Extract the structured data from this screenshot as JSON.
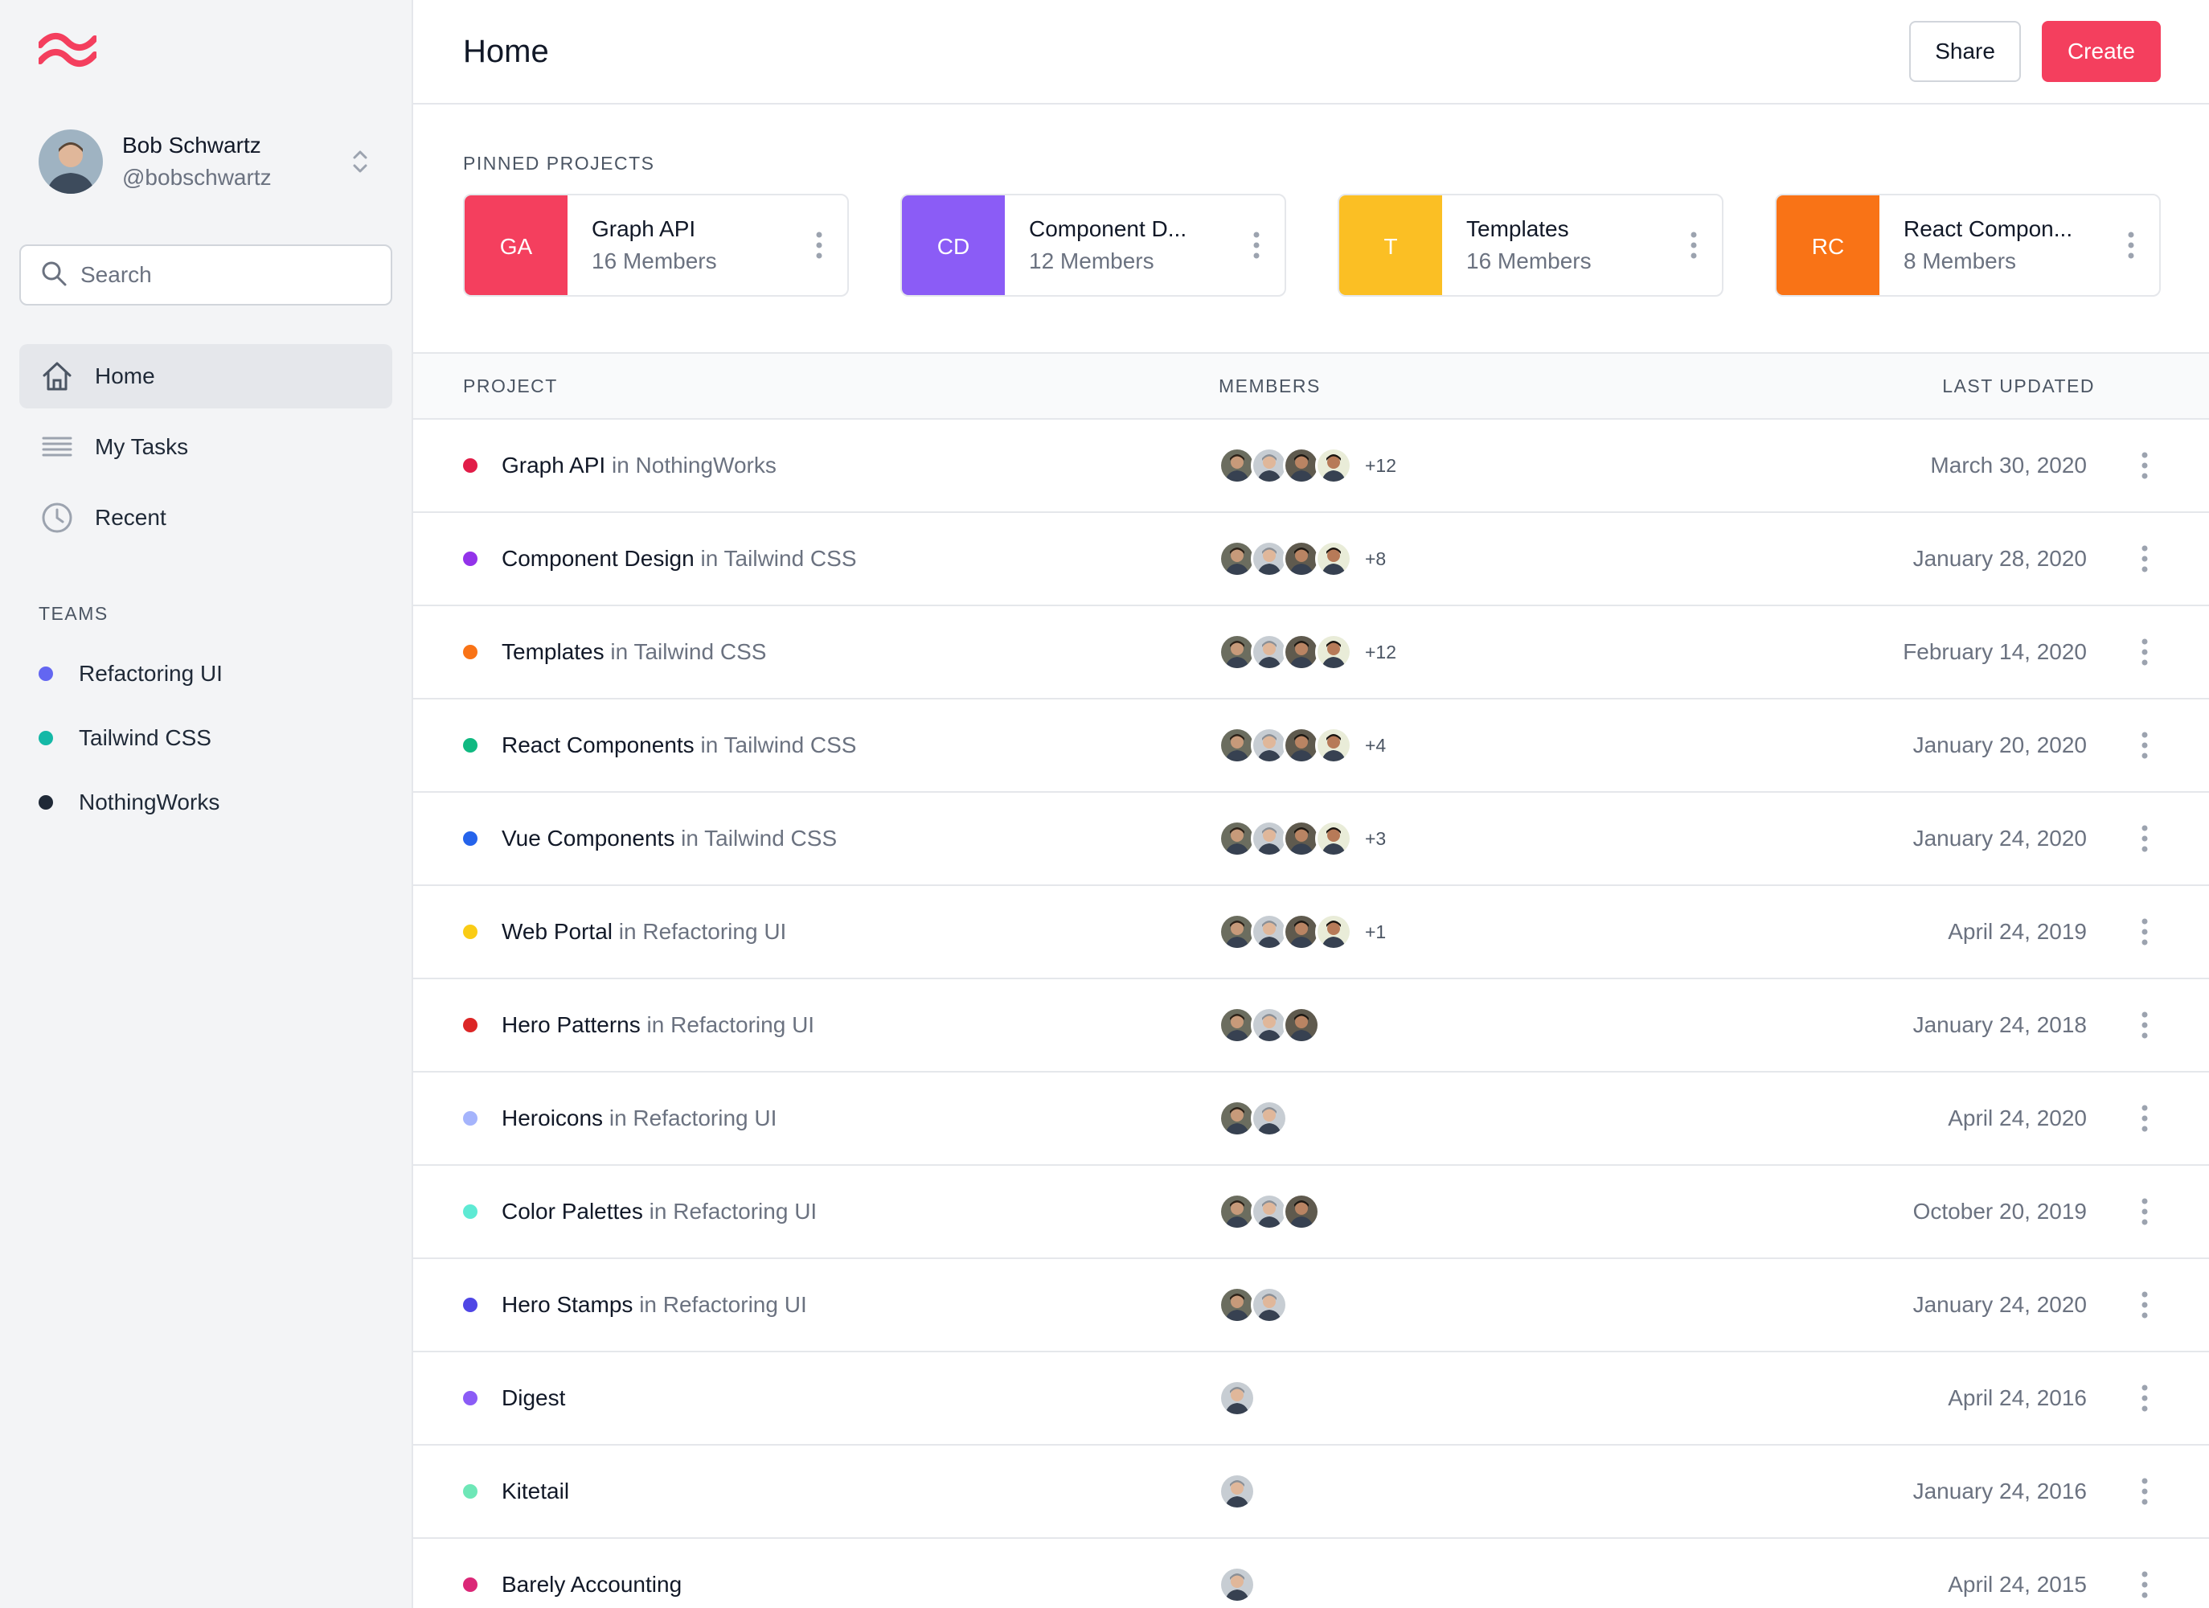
{
  "sidebar": {
    "user": {
      "name": "Bob Schwartz",
      "handle": "@bobschwartz"
    },
    "search": {
      "placeholder": "Search"
    },
    "nav": [
      {
        "label": "Home",
        "icon": "home-icon",
        "active": true
      },
      {
        "label": "My Tasks",
        "icon": "menu-lines-icon",
        "active": false
      },
      {
        "label": "Recent",
        "icon": "clock-icon",
        "active": false
      }
    ],
    "teams_title": "TEAMS",
    "teams": [
      {
        "label": "Refactoring UI",
        "color": "#6366f1"
      },
      {
        "label": "Tailwind CSS",
        "color": "#14b8a6"
      },
      {
        "label": "NothingWorks",
        "color": "#1f2937"
      }
    ]
  },
  "header": {
    "title": "Home",
    "share_label": "Share",
    "create_label": "Create"
  },
  "pinned": {
    "title": "PINNED PROJECTS",
    "items": [
      {
        "badge": "GA",
        "name": "Graph API",
        "members": "16 Members",
        "color": "#f43f5e"
      },
      {
        "badge": "CD",
        "name": "Component D...",
        "members": "12 Members",
        "color": "#8b5cf6"
      },
      {
        "badge": "T",
        "name": "Templates",
        "members": "16 Members",
        "color": "#fbbf24"
      },
      {
        "badge": "RC",
        "name": "React Compon...",
        "members": "8 Members",
        "color": "#f97316"
      }
    ]
  },
  "table": {
    "headers": {
      "project": "PROJECT",
      "members": "MEMBERS",
      "updated": "LAST UPDATED"
    },
    "rows": [
      {
        "name": "Graph API",
        "team": "in NothingWorks",
        "color": "#e11d48",
        "avatars": 4,
        "extra": "+12",
        "date": "March 30, 2020"
      },
      {
        "name": "Component Design",
        "team": "in Tailwind CSS",
        "color": "#9333ea",
        "avatars": 4,
        "extra": "+8",
        "date": "January 28, 2020"
      },
      {
        "name": "Templates",
        "team": "in Tailwind CSS",
        "color": "#f97316",
        "avatars": 4,
        "extra": "+12",
        "date": "February 14, 2020"
      },
      {
        "name": "React Components",
        "team": "in Tailwind CSS",
        "color": "#10b981",
        "avatars": 4,
        "extra": "+4",
        "date": "January 20, 2020"
      },
      {
        "name": "Vue Components",
        "team": "in Tailwind CSS",
        "color": "#2563eb",
        "avatars": 4,
        "extra": "+3",
        "date": "January 24, 2020"
      },
      {
        "name": "Web Portal",
        "team": "in Refactoring UI",
        "color": "#facc15",
        "avatars": 4,
        "extra": "+1",
        "date": "April 24, 2019"
      },
      {
        "name": "Hero Patterns",
        "team": "in Refactoring UI",
        "color": "#dc2626",
        "avatars": 3,
        "extra": "",
        "date": "January 24, 2018"
      },
      {
        "name": "Heroicons",
        "team": "in Refactoring UI",
        "color": "#a5b4fc",
        "avatars": 2,
        "extra": "",
        "date": "April 24, 2020"
      },
      {
        "name": "Color Palettes",
        "team": "in Refactoring UI",
        "color": "#5eead4",
        "avatars": 3,
        "extra": "",
        "date": "October 20, 2019"
      },
      {
        "name": "Hero Stamps",
        "team": "in Refactoring UI",
        "color": "#4f46e5",
        "avatars": 2,
        "extra": "",
        "date": "January 24, 2020"
      },
      {
        "name": "Digest",
        "team": "",
        "color": "#8b5cf6",
        "avatars": 1,
        "extra": "",
        "date": "April 24, 2016"
      },
      {
        "name": "Kitetail",
        "team": "",
        "color": "#6ee7b7",
        "avatars": 1,
        "extra": "",
        "date": "January 24, 2016"
      },
      {
        "name": "Barely Accounting",
        "team": "",
        "color": "#db2777",
        "avatars": 1,
        "extra": "",
        "date": "April 24, 2015"
      }
    ]
  }
}
